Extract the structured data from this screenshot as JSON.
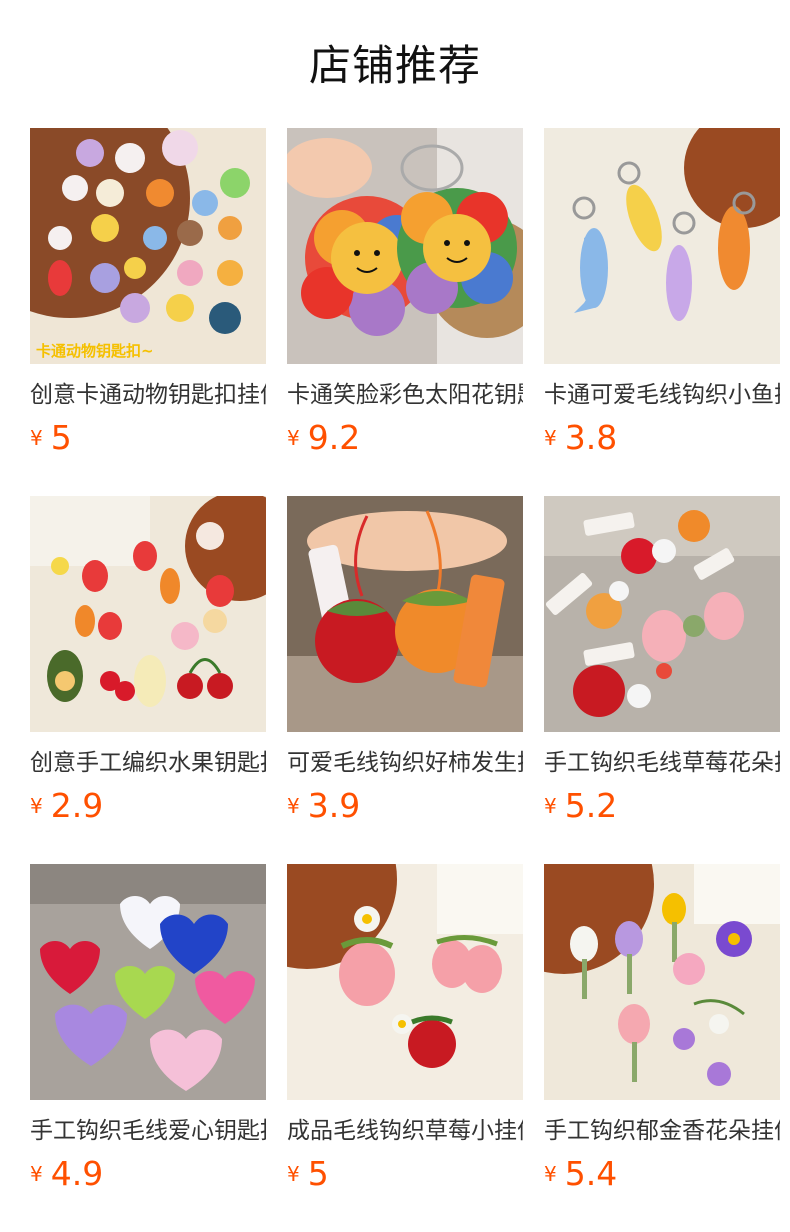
{
  "page_title": "店铺推荐",
  "accent_color": "#ff5000",
  "products": [
    {
      "name": "创意卡通动物钥匙扣挂件",
      "currency": "¥",
      "price": "5",
      "overlay": "卡通动物钥匙扣~",
      "image": "cartoon-animal-keychains-image"
    },
    {
      "name": "卡通笑脸彩色太阳花钥匙扣",
      "currency": "¥",
      "price": "9.2",
      "overlay": "",
      "image": "smiley-sunflower-keychains-image"
    },
    {
      "name": "卡通可爱毛线钩织小鱼挂件",
      "currency": "¥",
      "price": "3.8",
      "overlay": "",
      "image": "crochet-fish-keychains-image"
    },
    {
      "name": "创意手工编织水果钥匙扣",
      "currency": "¥",
      "price": "2.9",
      "overlay": "",
      "image": "crochet-fruit-keychains-image"
    },
    {
      "name": "可爱毛线钩织好柿发生挂件",
      "currency": "¥",
      "price": "3.9",
      "overlay": "",
      "image": "persimmon-strawberry-charms-image"
    },
    {
      "name": "手工钩织毛线草莓花朵挂件",
      "currency": "¥",
      "price": "5.2",
      "overlay": "",
      "image": "strawberry-flower-charms-image"
    },
    {
      "name": "手工钩织毛线爱心钥匙扣",
      "currency": "¥",
      "price": "4.9",
      "overlay": "",
      "image": "crochet-heart-keychains-image"
    },
    {
      "name": "成品毛线钩织草莓小挂件",
      "currency": "¥",
      "price": "5",
      "overlay": "",
      "image": "crochet-strawberry-keychains-image"
    },
    {
      "name": "手工钩织郁金香花朵挂件",
      "currency": "¥",
      "price": "5.4",
      "overlay": "",
      "image": "crochet-tulip-keychains-image"
    }
  ]
}
